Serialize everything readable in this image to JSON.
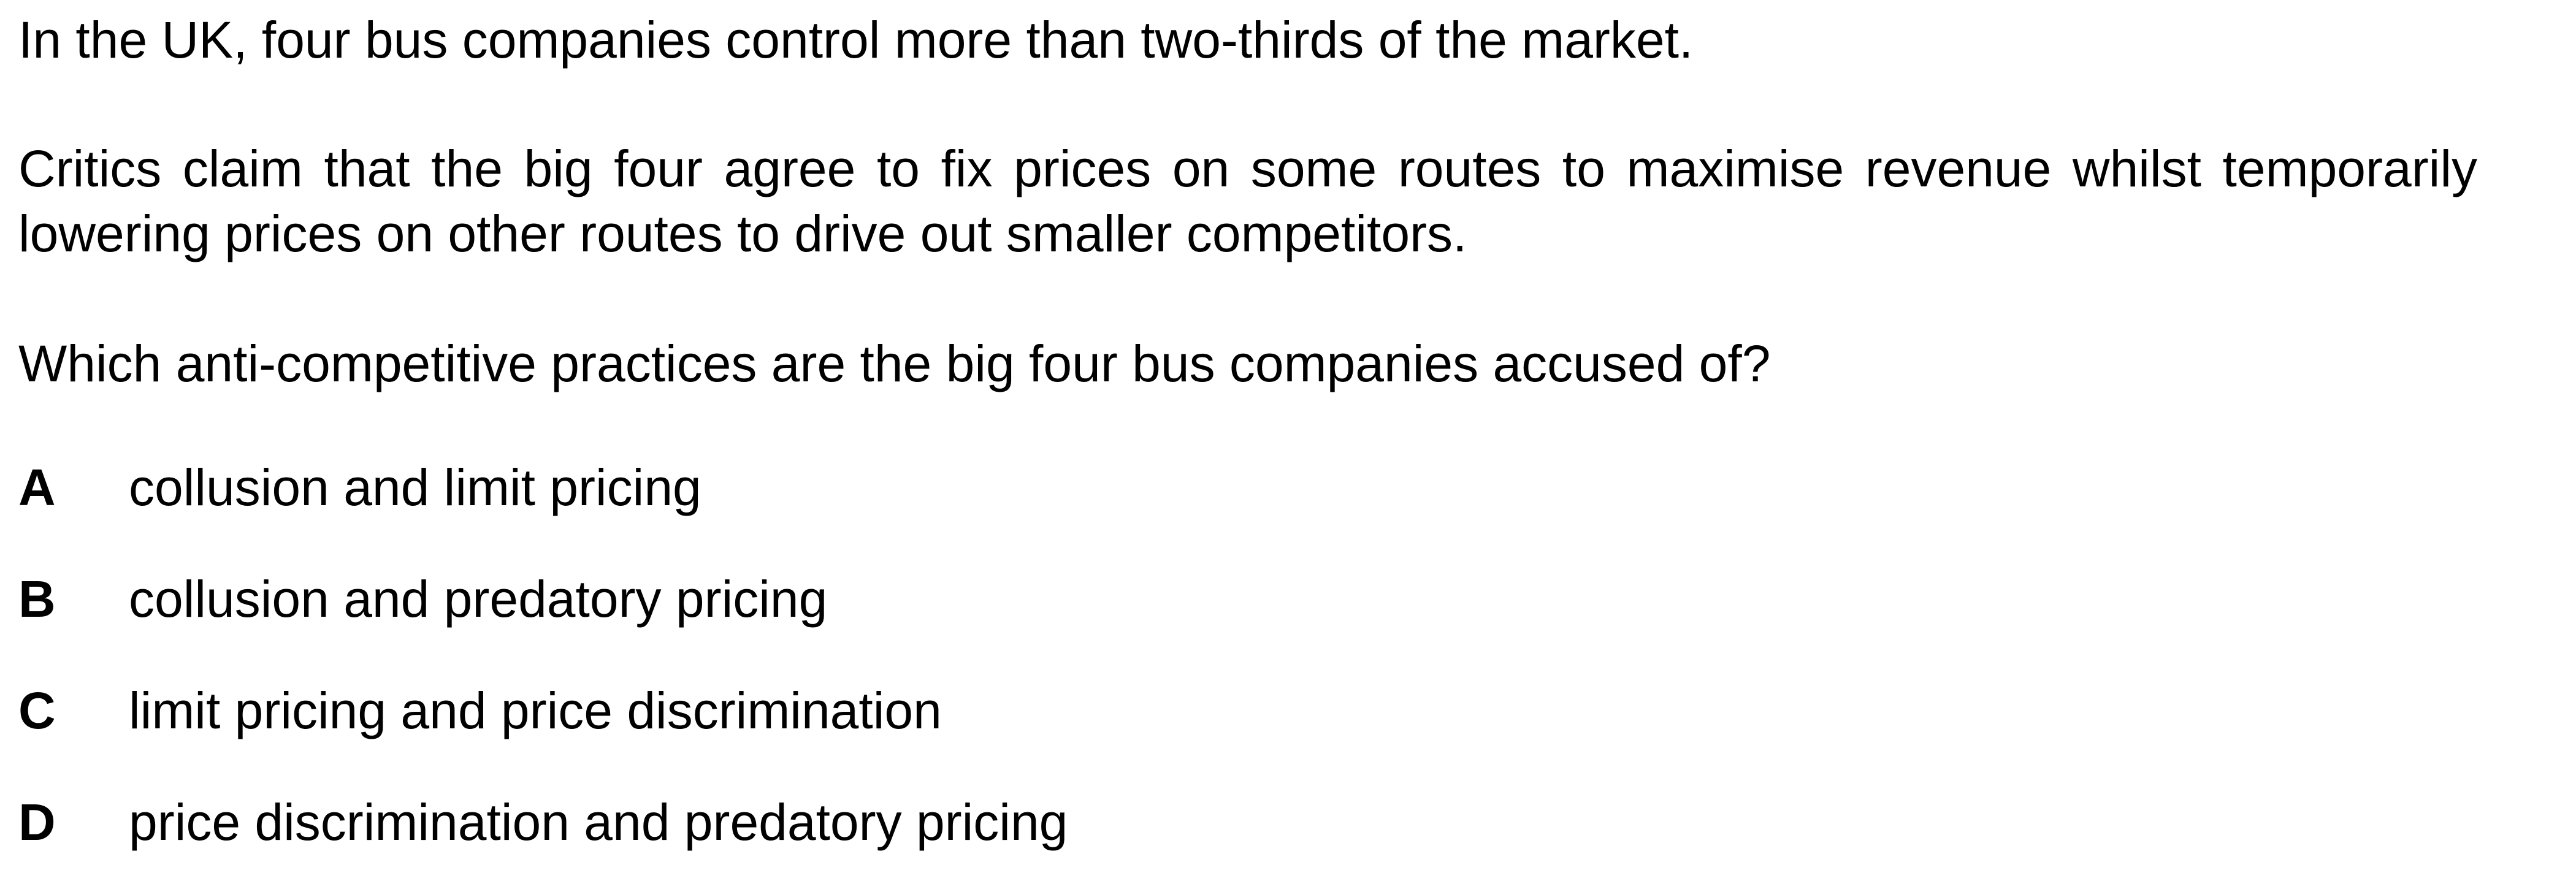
{
  "question": {
    "intro": "In the UK, four bus companies control more than two-thirds of the market.",
    "context": "Critics claim that the big four agree to fix prices on some routes to maximise revenue whilst temporarily lowering prices on other routes to drive out smaller competitors.",
    "prompt": "Which anti-competitive practices are the big four bus companies accused of?"
  },
  "options": [
    {
      "letter": "A",
      "text": "collusion and limit pricing"
    },
    {
      "letter": "B",
      "text": "collusion and predatory pricing"
    },
    {
      "letter": "C",
      "text": "limit pricing and price discrimination"
    },
    {
      "letter": "D",
      "text": "price discrimination and predatory pricing"
    }
  ]
}
